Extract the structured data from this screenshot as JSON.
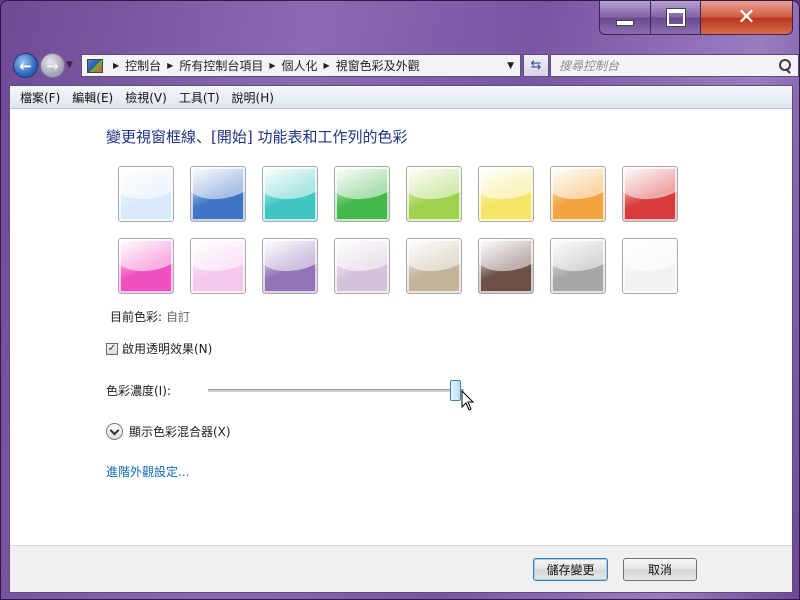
{
  "nav": {
    "breadcrumbs": [
      "控制台",
      "所有控制台項目",
      "個人化",
      "視窗色彩及外觀"
    ],
    "search_placeholder": "搜尋控制台"
  },
  "menu": [
    "檔案(F)",
    "編輯(E)",
    "檢視(V)",
    "工具(T)",
    "說明(H)"
  ],
  "main": {
    "heading": "變更視窗框線、[開始] 功能表和工作列的色彩",
    "swatch_colors": [
      [
        "#d9ebfa",
        "#3f74c6",
        "#3fc6c2",
        "#45b84b",
        "#9fd24c",
        "#f5e567",
        "#f4a43c",
        "#d83c3c"
      ],
      [
        "#f04fbf",
        "#f7c8ee",
        "#9273b8",
        "#d6c3db",
        "#c3b49a",
        "#6e5049",
        "#a7a7a7",
        "#f2f2f2"
      ]
    ],
    "current_label": "目前色彩:",
    "current_value": "自訂",
    "transparency_label": "啟用透明效果(N)",
    "transparency_checked": true,
    "intensity_label": "色彩濃度(I):",
    "intensity_value_fraction": 0.97,
    "mixer_label": "顯示色彩混合器(X)",
    "advanced_link": "進階外觀設定..."
  },
  "footer": {
    "save_label": "儲存變更",
    "cancel_label": "取消"
  },
  "colors": {
    "heading": "#1e3287",
    "link": "#0d6ab4",
    "frame": "#7a55a3"
  }
}
